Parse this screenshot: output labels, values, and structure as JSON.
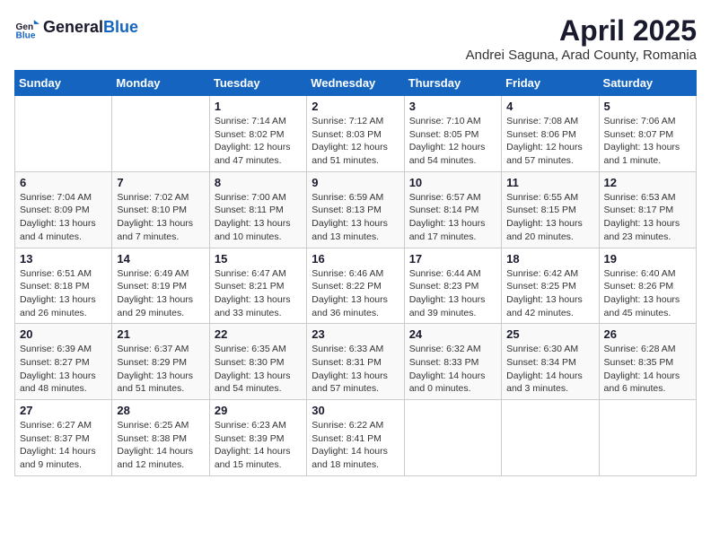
{
  "header": {
    "logo_general": "General",
    "logo_blue": "Blue",
    "month": "April 2025",
    "location": "Andrei Saguna, Arad County, Romania"
  },
  "days_of_week": [
    "Sunday",
    "Monday",
    "Tuesday",
    "Wednesday",
    "Thursday",
    "Friday",
    "Saturday"
  ],
  "weeks": [
    [
      {
        "num": "",
        "info": ""
      },
      {
        "num": "",
        "info": ""
      },
      {
        "num": "1",
        "info": "Sunrise: 7:14 AM\nSunset: 8:02 PM\nDaylight: 12 hours and 47 minutes."
      },
      {
        "num": "2",
        "info": "Sunrise: 7:12 AM\nSunset: 8:03 PM\nDaylight: 12 hours and 51 minutes."
      },
      {
        "num": "3",
        "info": "Sunrise: 7:10 AM\nSunset: 8:05 PM\nDaylight: 12 hours and 54 minutes."
      },
      {
        "num": "4",
        "info": "Sunrise: 7:08 AM\nSunset: 8:06 PM\nDaylight: 12 hours and 57 minutes."
      },
      {
        "num": "5",
        "info": "Sunrise: 7:06 AM\nSunset: 8:07 PM\nDaylight: 13 hours and 1 minute."
      }
    ],
    [
      {
        "num": "6",
        "info": "Sunrise: 7:04 AM\nSunset: 8:09 PM\nDaylight: 13 hours and 4 minutes."
      },
      {
        "num": "7",
        "info": "Sunrise: 7:02 AM\nSunset: 8:10 PM\nDaylight: 13 hours and 7 minutes."
      },
      {
        "num": "8",
        "info": "Sunrise: 7:00 AM\nSunset: 8:11 PM\nDaylight: 13 hours and 10 minutes."
      },
      {
        "num": "9",
        "info": "Sunrise: 6:59 AM\nSunset: 8:13 PM\nDaylight: 13 hours and 13 minutes."
      },
      {
        "num": "10",
        "info": "Sunrise: 6:57 AM\nSunset: 8:14 PM\nDaylight: 13 hours and 17 minutes."
      },
      {
        "num": "11",
        "info": "Sunrise: 6:55 AM\nSunset: 8:15 PM\nDaylight: 13 hours and 20 minutes."
      },
      {
        "num": "12",
        "info": "Sunrise: 6:53 AM\nSunset: 8:17 PM\nDaylight: 13 hours and 23 minutes."
      }
    ],
    [
      {
        "num": "13",
        "info": "Sunrise: 6:51 AM\nSunset: 8:18 PM\nDaylight: 13 hours and 26 minutes."
      },
      {
        "num": "14",
        "info": "Sunrise: 6:49 AM\nSunset: 8:19 PM\nDaylight: 13 hours and 29 minutes."
      },
      {
        "num": "15",
        "info": "Sunrise: 6:47 AM\nSunset: 8:21 PM\nDaylight: 13 hours and 33 minutes."
      },
      {
        "num": "16",
        "info": "Sunrise: 6:46 AM\nSunset: 8:22 PM\nDaylight: 13 hours and 36 minutes."
      },
      {
        "num": "17",
        "info": "Sunrise: 6:44 AM\nSunset: 8:23 PM\nDaylight: 13 hours and 39 minutes."
      },
      {
        "num": "18",
        "info": "Sunrise: 6:42 AM\nSunset: 8:25 PM\nDaylight: 13 hours and 42 minutes."
      },
      {
        "num": "19",
        "info": "Sunrise: 6:40 AM\nSunset: 8:26 PM\nDaylight: 13 hours and 45 minutes."
      }
    ],
    [
      {
        "num": "20",
        "info": "Sunrise: 6:39 AM\nSunset: 8:27 PM\nDaylight: 13 hours and 48 minutes."
      },
      {
        "num": "21",
        "info": "Sunrise: 6:37 AM\nSunset: 8:29 PM\nDaylight: 13 hours and 51 minutes."
      },
      {
        "num": "22",
        "info": "Sunrise: 6:35 AM\nSunset: 8:30 PM\nDaylight: 13 hours and 54 minutes."
      },
      {
        "num": "23",
        "info": "Sunrise: 6:33 AM\nSunset: 8:31 PM\nDaylight: 13 hours and 57 minutes."
      },
      {
        "num": "24",
        "info": "Sunrise: 6:32 AM\nSunset: 8:33 PM\nDaylight: 14 hours and 0 minutes."
      },
      {
        "num": "25",
        "info": "Sunrise: 6:30 AM\nSunset: 8:34 PM\nDaylight: 14 hours and 3 minutes."
      },
      {
        "num": "26",
        "info": "Sunrise: 6:28 AM\nSunset: 8:35 PM\nDaylight: 14 hours and 6 minutes."
      }
    ],
    [
      {
        "num": "27",
        "info": "Sunrise: 6:27 AM\nSunset: 8:37 PM\nDaylight: 14 hours and 9 minutes."
      },
      {
        "num": "28",
        "info": "Sunrise: 6:25 AM\nSunset: 8:38 PM\nDaylight: 14 hours and 12 minutes."
      },
      {
        "num": "29",
        "info": "Sunrise: 6:23 AM\nSunset: 8:39 PM\nDaylight: 14 hours and 15 minutes."
      },
      {
        "num": "30",
        "info": "Sunrise: 6:22 AM\nSunset: 8:41 PM\nDaylight: 14 hours and 18 minutes."
      },
      {
        "num": "",
        "info": ""
      },
      {
        "num": "",
        "info": ""
      },
      {
        "num": "",
        "info": ""
      }
    ]
  ]
}
